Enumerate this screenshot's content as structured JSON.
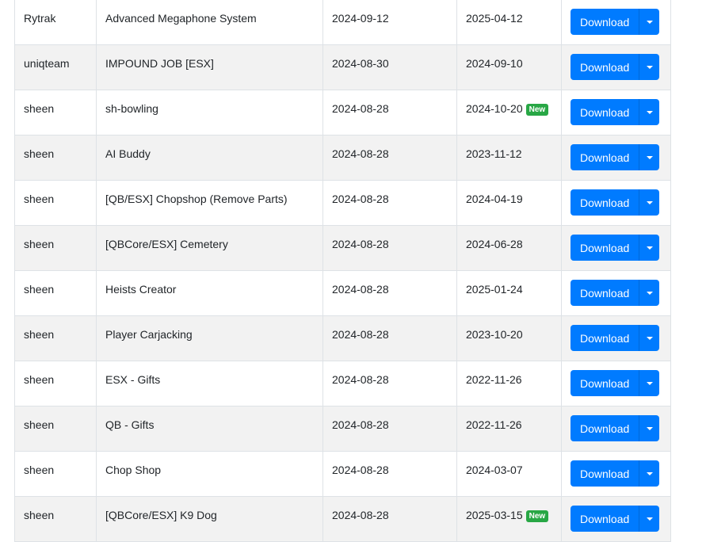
{
  "table": {
    "download_label": "Download",
    "badge_label": "New",
    "rows": [
      {
        "author": "Rytrak",
        "name": "Advanced Megaphone System",
        "added": "2024-09-12",
        "updated": "2025-04-12",
        "is_new": false
      },
      {
        "author": "uniqteam",
        "name": "IMPOUND JOB [ESX]",
        "added": "2024-08-30",
        "updated": "2024-09-10",
        "is_new": false
      },
      {
        "author": "sheen",
        "name": "sh-bowling",
        "added": "2024-08-28",
        "updated": "2024-10-20",
        "is_new": true
      },
      {
        "author": "sheen",
        "name": "AI Buddy",
        "added": "2024-08-28",
        "updated": "2023-11-12",
        "is_new": false
      },
      {
        "author": "sheen",
        "name": "[QB/ESX] Chopshop (Remove Parts)",
        "added": "2024-08-28",
        "updated": "2024-04-19",
        "is_new": false
      },
      {
        "author": "sheen",
        "name": "[QBCore/ESX] Cemetery",
        "added": "2024-08-28",
        "updated": "2024-06-28",
        "is_new": false
      },
      {
        "author": "sheen",
        "name": "Heists Creator",
        "added": "2024-08-28",
        "updated": "2025-01-24",
        "is_new": false
      },
      {
        "author": "sheen",
        "name": "Player Carjacking",
        "added": "2024-08-28",
        "updated": "2023-10-20",
        "is_new": false
      },
      {
        "author": "sheen",
        "name": "ESX - Gifts",
        "added": "2024-08-28",
        "updated": "2022-11-26",
        "is_new": false
      },
      {
        "author": "sheen",
        "name": "QB - Gifts",
        "added": "2024-08-28",
        "updated": "2022-11-26",
        "is_new": false
      },
      {
        "author": "sheen",
        "name": "Chop Shop",
        "added": "2024-08-28",
        "updated": "2024-03-07",
        "is_new": false
      },
      {
        "author": "sheen",
        "name": "[QBCore/ESX] K9 Dog",
        "added": "2024-08-28",
        "updated": "2025-03-15",
        "is_new": true
      }
    ]
  },
  "colors": {
    "primary": "#007bff",
    "badge": "#28a745",
    "stripe": "#f2f2f2"
  },
  "icons": {
    "dropdown": "caret-down-icon"
  }
}
